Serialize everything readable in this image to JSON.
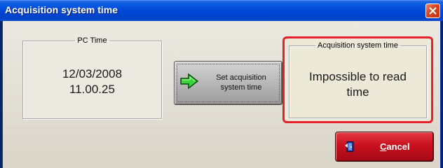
{
  "window": {
    "title": "Acquisition system time",
    "close_icon": "close-icon"
  },
  "pc_time": {
    "legend": "PC Time",
    "date": "12/03/2008",
    "time": "11.00.25"
  },
  "set_button": {
    "line1": "Set acquisition",
    "line2": "system time",
    "icon": "green-arrow-right-icon"
  },
  "acquisition": {
    "legend": "Acquisition system time",
    "line1": "Impossible to read",
    "line2": "time",
    "highlight_color": "#e8202a"
  },
  "cancel_button": {
    "mnemonic": "C",
    "rest": "ancel",
    "icon": "cancel-door-icon"
  },
  "colors": {
    "titlebar": "#0048d8",
    "dialog_bg": "#ece9d8",
    "cancel_bg": "#c8101e"
  }
}
